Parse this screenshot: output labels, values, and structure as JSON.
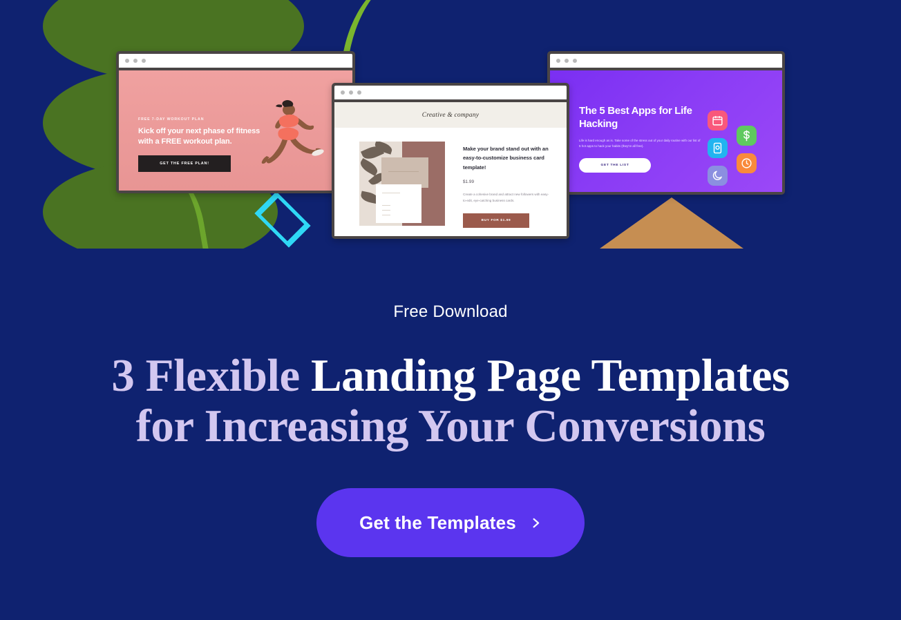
{
  "background": {
    "navy": "#0f2270",
    "leaf_green": "#4a7322",
    "stem_green": "#7ab52e",
    "diamond_cyan": "#2fd8f5",
    "triangle_tan": "#c68e52"
  },
  "hero": {
    "mockups": [
      {
        "id": "fitness",
        "eyebrow": "FREE 7-DAY WORKOUT PLAN",
        "headline": "Kick off your next phase of fitness with a FREE workout plan.",
        "button": "GET THE FREE PLAN!",
        "accent": "#f0a1a0"
      },
      {
        "id": "business-card",
        "logo": "Creative & company",
        "headline": "Make your brand stand out with an easy-to-customize business card template!",
        "price": "$1.99",
        "description": "Create a cohesive brand and attract new followers with easy-to-edit, eye-catching business cards.",
        "button": "BUY FOR $1.99",
        "accent": "#9b5a4c"
      },
      {
        "id": "life-hacking-apps",
        "headline": "The 5 Best Apps for Life Hacking",
        "description": "Life is hard enough as is. Take some of the stress out of your daily routine with our list of 5 hot apps to hack your habits (they're all free).",
        "button": "GET THE LIST",
        "accent": "#8a3cf5",
        "app_icons": [
          {
            "name": "calendar-icon",
            "color": "#f9587b"
          },
          {
            "name": "dollar-icon",
            "color": "#5fc95f"
          },
          {
            "name": "camera-icon",
            "color": "#22b4f0"
          },
          {
            "name": "clock-icon",
            "color": "#f98a3c"
          },
          {
            "name": "moon-icon",
            "color": "#8b8fe0"
          }
        ]
      }
    ]
  },
  "content": {
    "eyebrow": "Free Download",
    "headline_line1_accent": "3 Flexible",
    "headline_line1_white": " Landing Page Templates",
    "headline_line2": "for Increasing Your Conversions",
    "cta_label": "Get the Templates",
    "cta_color": "#5b35ef"
  }
}
